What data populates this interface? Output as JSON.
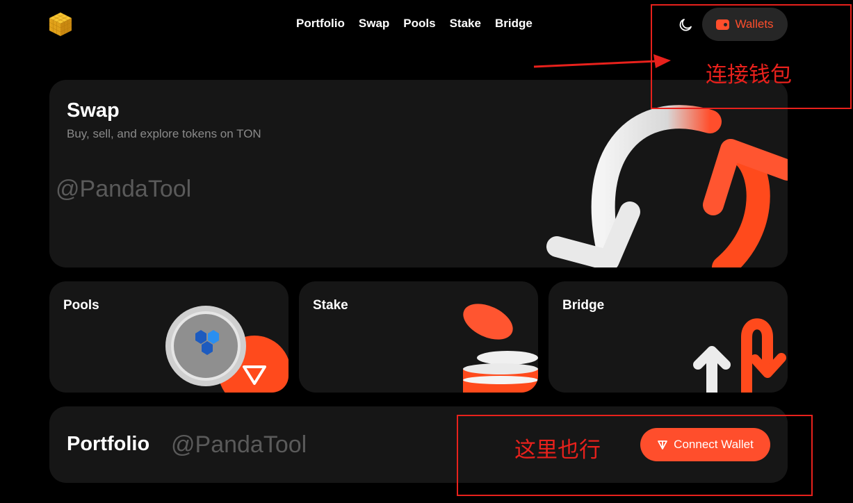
{
  "header": {
    "logo_icon": "gold-cube-logo-icon",
    "nav": [
      {
        "label": "Portfolio"
      },
      {
        "label": "Swap"
      },
      {
        "label": "Pools"
      },
      {
        "label": "Stake"
      },
      {
        "label": "Bridge"
      }
    ],
    "theme_icon": "moon-icon",
    "wallets_label": "Wallets"
  },
  "swap_card": {
    "title": "Swap",
    "subtitle": "Buy, sell, and explore tokens on TON",
    "watermark": "@PandaTool"
  },
  "pools_card": {
    "title": "Pools"
  },
  "stake_card": {
    "title": "Stake"
  },
  "bridge_card": {
    "title": "Bridge"
  },
  "portfolio_card": {
    "title": "Portfolio",
    "watermark": "@PandaTool",
    "connect_label": "Connect Wallet"
  },
  "annotations": {
    "wallet_note": "连接钱包",
    "connect_note": "这里也行"
  },
  "colors": {
    "accent": "#ff4e2c",
    "background": "#000000",
    "card": "#161616",
    "annotation": "#e8211c"
  }
}
